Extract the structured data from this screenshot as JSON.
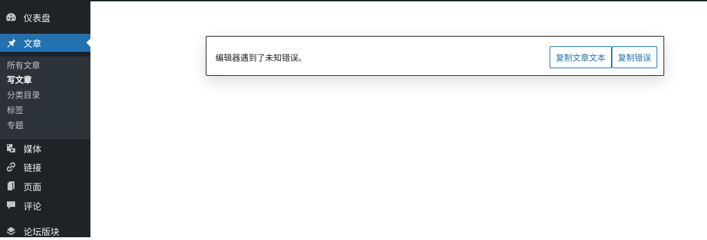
{
  "colors": {
    "sidebar_bg": "#1d2327",
    "submenu_bg": "#2c3338",
    "accent": "#2271b1",
    "text_light": "#f0f0f1"
  },
  "sidebar": {
    "items": [
      {
        "label": "仪表盘",
        "icon": "dashboard-icon"
      },
      {
        "label": "文章",
        "icon": "pin-icon",
        "active": true
      },
      {
        "label": "媒体",
        "icon": "media-icon"
      },
      {
        "label": "链接",
        "icon": "link-icon"
      },
      {
        "label": "页面",
        "icon": "pages-icon"
      },
      {
        "label": "评论",
        "icon": "comment-icon"
      },
      {
        "label": "论坛版块",
        "icon": "forum-icon"
      }
    ],
    "submenu": [
      {
        "label": "所有文章"
      },
      {
        "label": "写文章",
        "current": true
      },
      {
        "label": "分类目录"
      },
      {
        "label": "标签"
      },
      {
        "label": "专题"
      }
    ]
  },
  "notice": {
    "message": "编辑器遇到了未知错误。",
    "copy_text_label": "复制文章文本",
    "copy_error_label": "复制错误"
  }
}
